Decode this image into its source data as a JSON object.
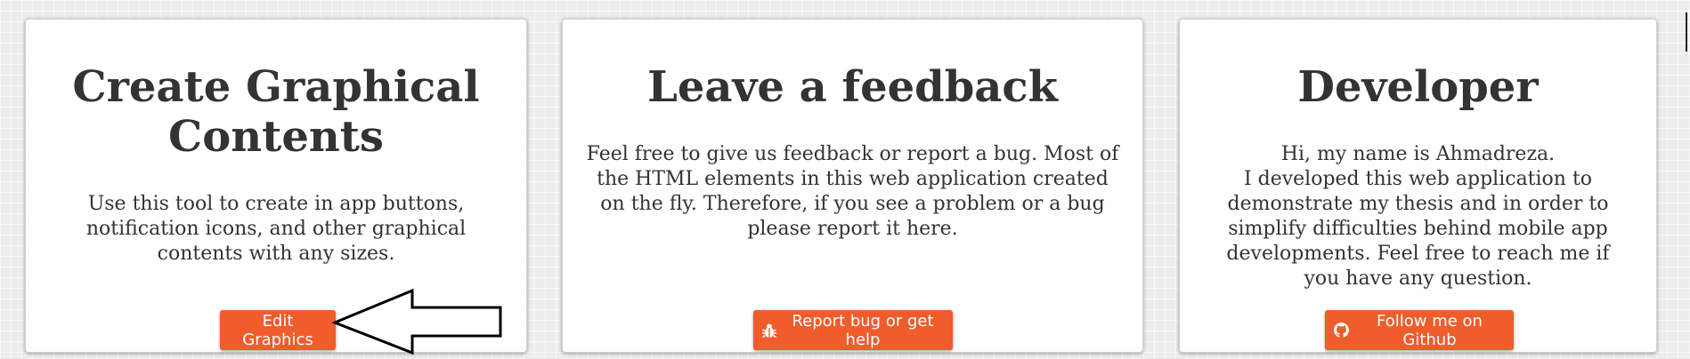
{
  "cards": [
    {
      "title": "Create Graphical Contents",
      "description": "Use this tool to create in app buttons, notification icons, and other graphical contents with any sizes.",
      "button": {
        "label": "Edit Graphics",
        "icon": ""
      }
    },
    {
      "title": "Leave a feedback",
      "description": "Feel free to give us feedback or report a bug. Most of the HTML elements in this web application created on the fly. Therefore, if you see a problem or a bug please report it here.",
      "button": {
        "label": "Report bug or get help",
        "icon": "bug-icon"
      }
    },
    {
      "title": "Developer",
      "description_lines": [
        "Hi, my name is Ahmadreza.",
        "I developed this web application to demonstrate my thesis and in order to simplify difficulties behind mobile app developments. Feel free to reach me if you have any question."
      ],
      "button": {
        "label": "Follow me on Github",
        "icon": "github-icon"
      }
    }
  ],
  "annotation": {
    "icon": "arrow-left-icon",
    "points_to": "Edit Graphics"
  },
  "colors": {
    "button": "#f05c2c",
    "button_text": "#ffffff",
    "text": "#333333",
    "card": "#ffffff",
    "background": "#ededed"
  }
}
